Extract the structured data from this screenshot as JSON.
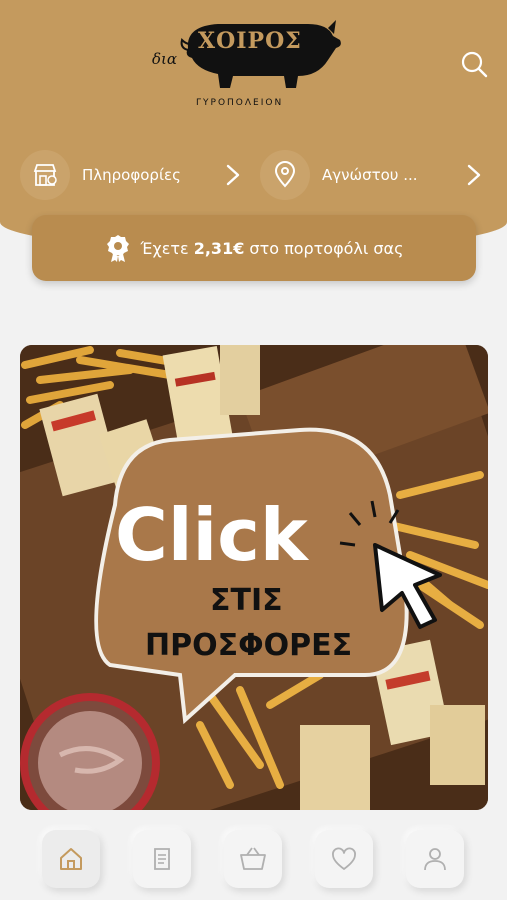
{
  "logo": {
    "prefix": "δια",
    "name": "ΧΟΙΡΟΣ",
    "subtitle": "ΓΥΡΟΠΟΛΕΙΟΝ"
  },
  "nav": {
    "info_label": "Πληροφορίες",
    "location_label": "Αγνώστου ..."
  },
  "wallet": {
    "prefix": "Έχετε",
    "amount": "2,31€",
    "suffix": "στο πορτοφόλι σας"
  },
  "banner": {
    "line1": "Click",
    "line2": "ΣΤΙΣ",
    "line3": "ΠΡΟΣΦΟΡΕΣ"
  },
  "bottom_nav": {
    "items": [
      {
        "icon": "home-icon",
        "active": true
      },
      {
        "icon": "orders-icon",
        "active": false
      },
      {
        "icon": "cart-icon",
        "active": false
      },
      {
        "icon": "heart-icon",
        "active": false
      },
      {
        "icon": "user-icon",
        "active": false
      }
    ]
  },
  "colors": {
    "brand": "#c49a5e",
    "wallet_bg": "#b98c4f",
    "banner_bubble": "#a9784a"
  }
}
